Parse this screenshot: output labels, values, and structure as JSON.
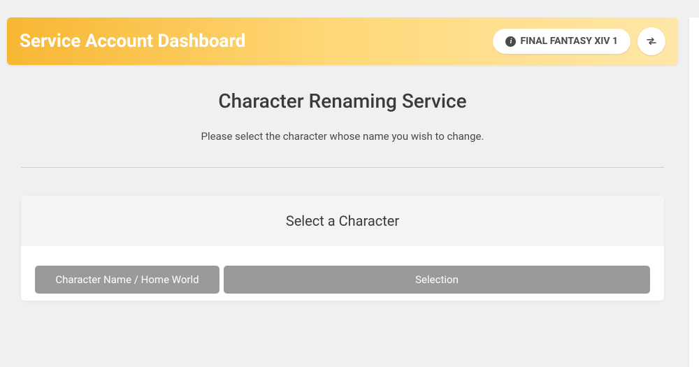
{
  "header": {
    "title": "Service Account Dashboard",
    "account_label": "FINAL FANTASY XIV 1"
  },
  "main": {
    "title": "Character Renaming Service",
    "subtitle": "Please select the character whose name you wish to change."
  },
  "card": {
    "header": "Select a Character",
    "columns": {
      "name": "Character Name / Home World",
      "selection": "Selection"
    }
  }
}
